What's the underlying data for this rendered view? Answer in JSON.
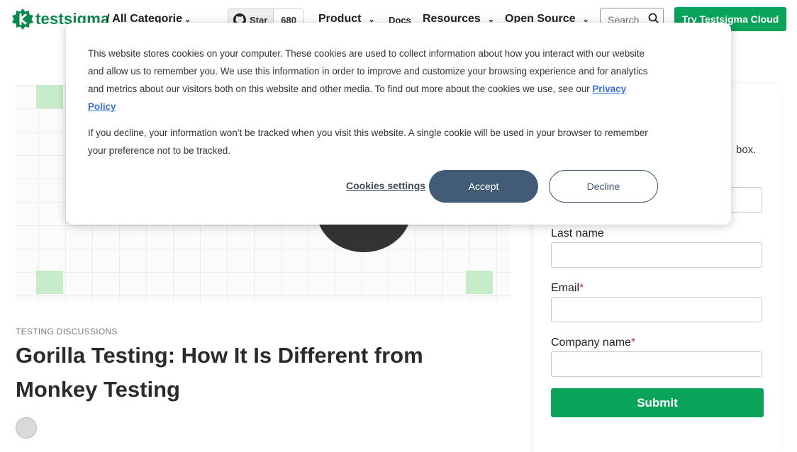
{
  "header": {
    "logo_text": "testsigma",
    "category": "/ All Categorie",
    "github_star": "Star",
    "github_count": "680",
    "nav": {
      "product": "Product",
      "docs": "Docs",
      "resources": "Resources",
      "open_source": "Open Source"
    },
    "search_placeholder": "Search",
    "cta": "Try Testsigma Cloud"
  },
  "article": {
    "category": "TESTING DISCUSSIONS",
    "title": "Gorilla Testing: How It Is Different from Monkey Testing"
  },
  "form": {
    "desc_fragment": "box.",
    "last_name_label": "Last name",
    "email_label": "Email",
    "company_label": "Company name",
    "required_mark": "*",
    "submit": "Submit"
  },
  "cookie": {
    "p1": "This website stores cookies on your computer. These cookies are used to collect information about how you interact with our website and allow us to remember you. We use this information in order to improve and customize your browsing experience and for analytics and metrics about our visitors both on this website and other media. To find out more about the cookies we use, see our",
    "privacy_link": "Privacy Policy",
    "p2": "If you decline, your information won’t be tracked when you visit this website. A single cookie will be used in your browser to remember your preference not to be tracked.",
    "settings": "Cookies settings",
    "accept": "Accept",
    "decline": "Decline"
  },
  "colors": {
    "brand_green": "#0aa35a",
    "modal_button": "#425b76"
  }
}
